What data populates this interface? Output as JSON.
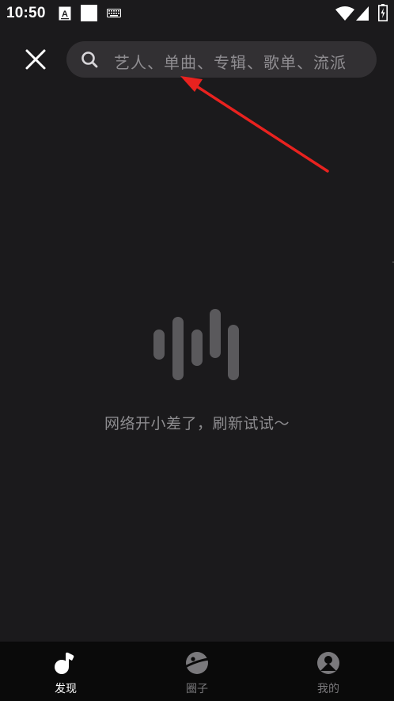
{
  "status_bar": {
    "time": "10:50",
    "icons": [
      "a-keyboard-icon",
      "square-icon",
      "keyboard-icon",
      "wifi-icon",
      "signal-icon",
      "battery-icon"
    ]
  },
  "search": {
    "placeholder": "艺人、单曲、专辑、歌单、流派"
  },
  "main": {
    "error_message": "网络开小差了，刷新试试～"
  },
  "bottom_nav": {
    "items": [
      {
        "label": "发现",
        "icon": "music-note-icon",
        "active": true
      },
      {
        "label": "圈子",
        "icon": "planet-icon",
        "active": false
      },
      {
        "label": "我的",
        "icon": "user-icon",
        "active": false
      }
    ]
  },
  "colors": {
    "background": "#1b1a1c",
    "search_bg": "#323033",
    "annotation": "#e8221f",
    "nav_bg": "#0a0a0a"
  }
}
